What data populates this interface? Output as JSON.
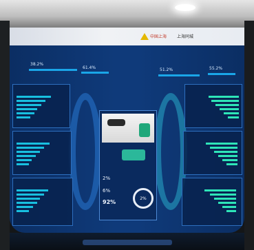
{
  "header": {
    "bank_name": "中国上海",
    "city_name": "上海同城",
    "logo_icon": "bank-logo-icon"
  },
  "top_metrics": [
    "38.2%",
    "61.4%",
    "51.2%",
    "55.2%"
  ],
  "center_card": {
    "stats": [
      "2%",
      "6%",
      "92%"
    ],
    "ring_value": "2%"
  }
}
